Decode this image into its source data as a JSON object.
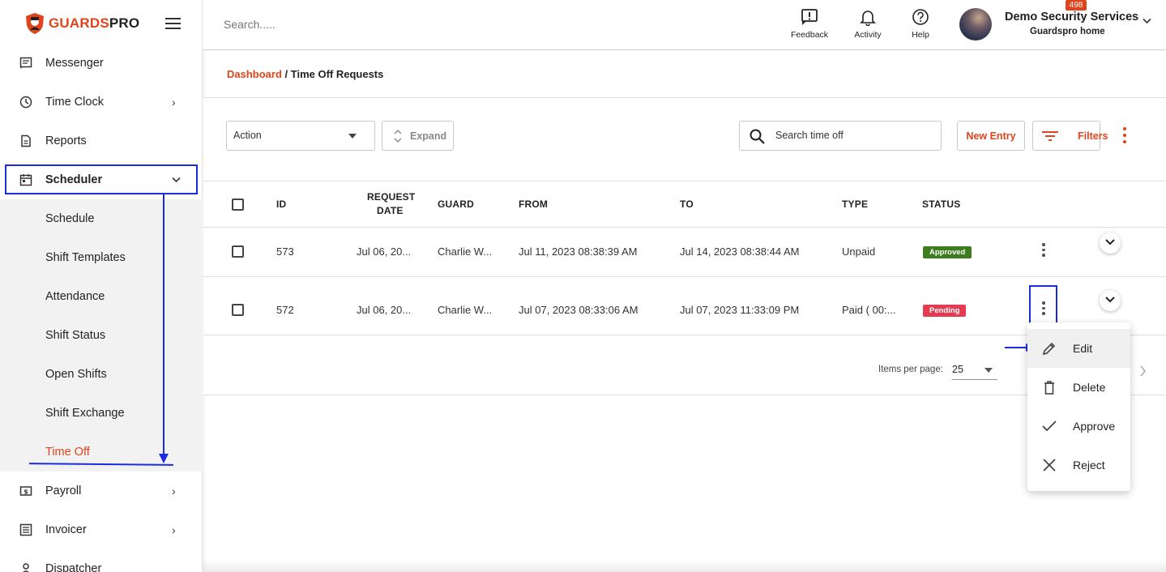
{
  "brand": {
    "name_part1": "GUARDS",
    "name_part2": "PRO",
    "accent_color": "#e0441c"
  },
  "sidebar": {
    "items": [
      {
        "label": "Messenger",
        "icon": "message-icon"
      },
      {
        "label": "Time Clock",
        "icon": "clock-icon",
        "chevron": "›"
      },
      {
        "label": "Reports",
        "icon": "document-icon"
      },
      {
        "label": "Scheduler",
        "icon": "calendar-icon",
        "chevron": "⌄"
      },
      {
        "label": "Payroll",
        "icon": "dollar-icon",
        "chevron": "›"
      },
      {
        "label": "Invoicer",
        "icon": "list-icon",
        "chevron": "›"
      },
      {
        "label": "Dispatcher",
        "icon": "person-icon"
      }
    ],
    "scheduler_sub": [
      "Schedule",
      "Shift Templates",
      "Attendance",
      "Shift Status",
      "Open Shifts",
      "Shift Exchange",
      "Time Off"
    ]
  },
  "header": {
    "search_placeholder": "Search.....",
    "feedback_label": "Feedback",
    "activity_label": "Activity",
    "activity_badge": "498",
    "help_label": "Help",
    "user_name": "Demo Security Services",
    "user_sub": "Guardspro home"
  },
  "breadcrumb": {
    "home": "Dashboard",
    "sep": " / ",
    "current": "Time Off Requests"
  },
  "toolbar": {
    "action_label": "Action",
    "expand_label": "Expand",
    "search_placeholder": "Search time off",
    "new_entry_label": "New Entry",
    "filters_label": "Filters"
  },
  "table": {
    "headers": {
      "id": "ID",
      "request_date_1": "REQUEST",
      "request_date_2": "DATE",
      "guard": "GUARD",
      "from": "FROM",
      "to": "TO",
      "type": "TYPE",
      "status": "STATUS"
    },
    "rows": [
      {
        "id": "573",
        "request_date": "Jul 06, 20...",
        "guard": "Charlie W...",
        "from": "Jul 11, 2023 08:38:39 AM",
        "to": "Jul 14, 2023 08:38:44 AM",
        "type": "Unpaid",
        "status": "Approved"
      },
      {
        "id": "572",
        "request_date": "Jul 06, 20...",
        "guard": "Charlie W...",
        "from": "Jul 07, 2023 08:33:06 AM",
        "to": "Jul 07, 2023 11:33:09 PM",
        "type": "Paid ( 00:...",
        "status": "Pending"
      }
    ]
  },
  "pager": {
    "items_per_page_label": "Items per page:",
    "items_per_page_value": "25"
  },
  "row_menu": {
    "edit": "Edit",
    "delete": "Delete",
    "approve": "Approve",
    "reject": "Reject"
  },
  "colors": {
    "annotation": "#1a2be0",
    "approved": "#3e7d1f",
    "pending": "#e23b52"
  }
}
